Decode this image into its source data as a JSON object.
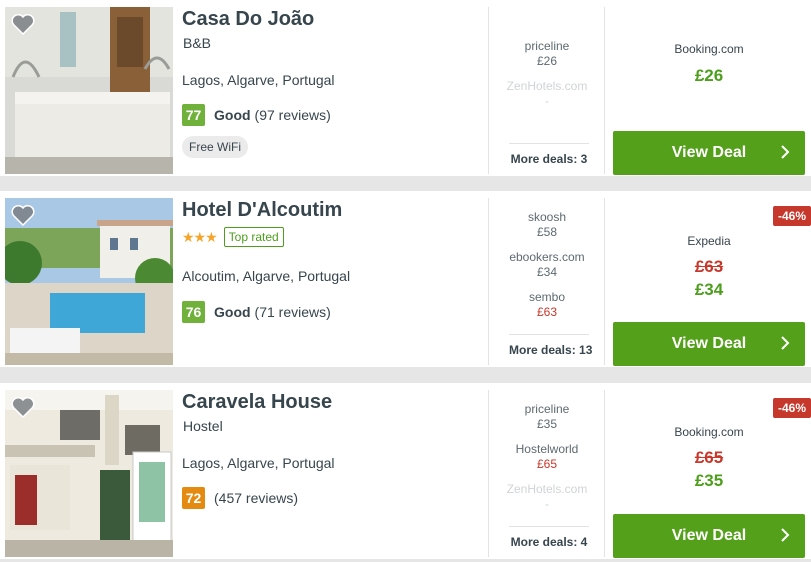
{
  "hotels": [
    {
      "name": "Casa Do João",
      "type": "B&B",
      "location": "Lagos, Algarve, Portugal",
      "rating": "77",
      "rating_word": "Good",
      "reviews": "(97 reviews)",
      "amenity": "Free WiFi",
      "deals": [
        {
          "provider": "priceline",
          "price": "£26"
        },
        {
          "provider": "ZenHotels.com",
          "price": "-"
        }
      ],
      "more_deals": "More deals: 3",
      "best": {
        "provider": "Booking.com",
        "price": "£26"
      },
      "button": "View Deal"
    },
    {
      "name": "Hotel D'Alcoutim",
      "stars": "★★★",
      "top_rated": "Top rated",
      "location": "Alcoutim, Algarve, Portugal",
      "rating": "76",
      "rating_word": "Good",
      "reviews": "(71 reviews)",
      "deals": [
        {
          "provider": "skoosh",
          "price": "£58"
        },
        {
          "provider": "ebookers.com",
          "price": "£34"
        },
        {
          "provider": "sembo",
          "price": "£63"
        }
      ],
      "more_deals": "More deals: 13",
      "discount": "-46%",
      "best": {
        "provider": "Expedia",
        "old_price": "£63",
        "price": "£34"
      },
      "button": "View Deal"
    },
    {
      "name": "Caravela House",
      "type": "Hostel",
      "location": "Lagos, Algarve, Portugal",
      "rating": "72",
      "reviews": "(457 reviews)",
      "deals": [
        {
          "provider": "priceline",
          "price": "£35"
        },
        {
          "provider": "Hostelworld",
          "price": "£65"
        },
        {
          "provider": "ZenHotels.com",
          "price": "-"
        }
      ],
      "more_deals": "More deals: 4",
      "discount": "-46%",
      "best": {
        "provider": "Booking.com",
        "old_price": "£65",
        "price": "£35"
      },
      "button": "View Deal"
    }
  ],
  "colors": {
    "accent": "#54a01b",
    "discount": "#c6382b",
    "good": "#6fb13a",
    "okay": "#e58a10"
  }
}
